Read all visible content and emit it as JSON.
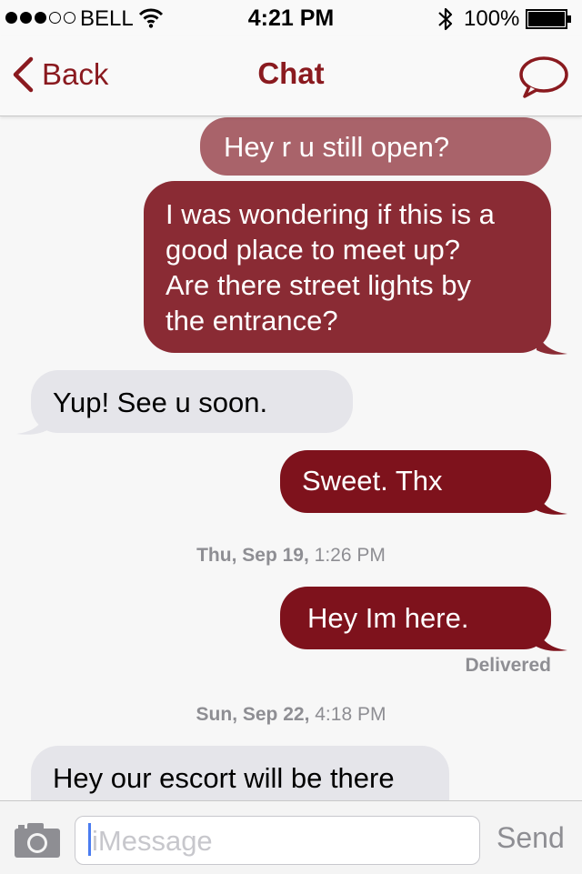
{
  "status_bar": {
    "carrier": "BELL",
    "time": "4:21 PM",
    "battery": "100%",
    "signal_bars_filled": 3,
    "signal_bars_total": 5
  },
  "nav": {
    "back_label": "Back",
    "title": "Chat",
    "compose_icon": "speech-bubble-icon"
  },
  "colors": {
    "accent": "#8a1a1f",
    "bubble_out_light": "#a9636a",
    "bubble_out_mid": "#8a2b34",
    "bubble_out_dark": "#7e121c",
    "bubble_in": "#e5e5ea"
  },
  "messages": [
    {
      "direction": "out",
      "text": "Hey r u still open?"
    },
    {
      "direction": "out",
      "text": "I was wondering if this is a good place to meet up? Are there street lights by the entrance?"
    },
    {
      "direction": "in",
      "text": "Yup! See u soon."
    },
    {
      "direction": "out",
      "text": "Sweet. Thx"
    },
    {
      "direction": "out",
      "text": "Hey Im here."
    },
    {
      "direction": "in",
      "text": "Hey our escort will be there"
    }
  ],
  "message_lines": {
    "m2": [
      "I was wondering if this is a",
      "good place to meet up?",
      "Are there street lights by",
      "the entrance?"
    ]
  },
  "timestamps": [
    {
      "day": "Thu, Sep 19,",
      "time": "1:26 PM"
    },
    {
      "day": "Sun, Sep 22,",
      "time": "4:18 PM"
    }
  ],
  "delivered_label": "Delivered",
  "input": {
    "placeholder": "iMessage",
    "send_label": "Send"
  }
}
